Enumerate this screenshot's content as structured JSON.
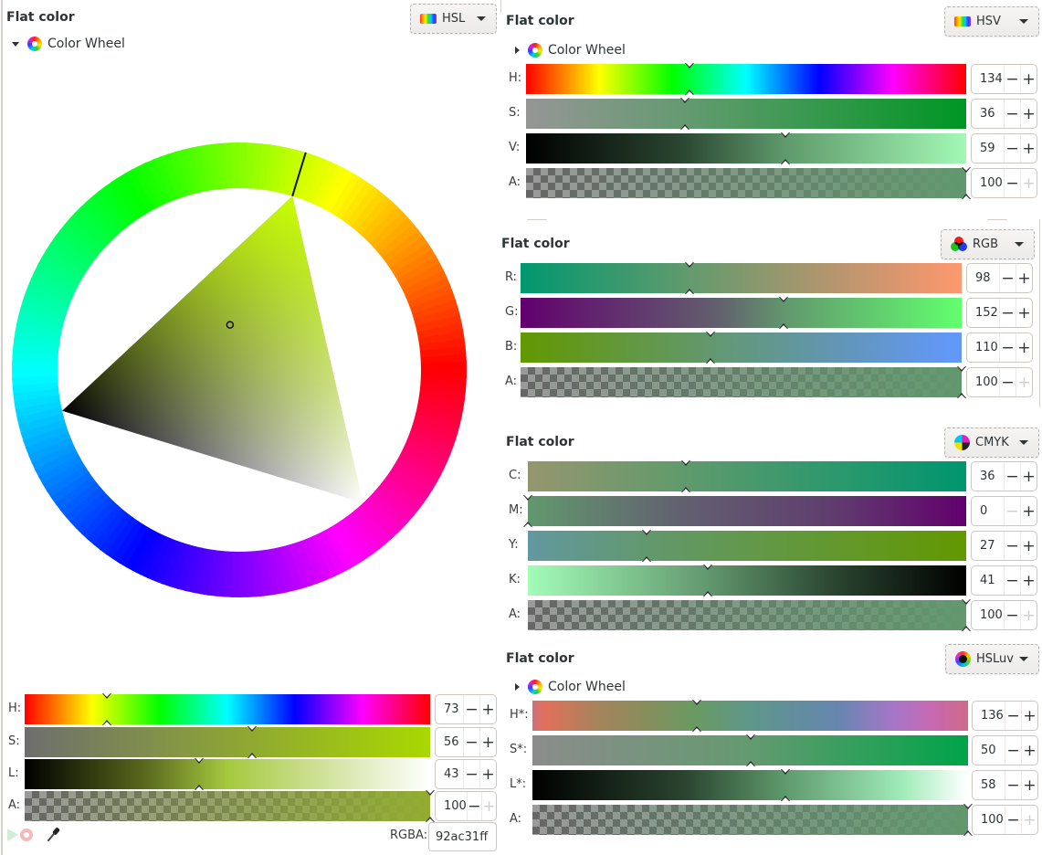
{
  "panels": {
    "hsl": {
      "title": "Flat color",
      "mode_label": "HSL",
      "mode_icon": "spectrum-icon",
      "color_wheel_label": "Color Wheel",
      "color_wheel_expanded": true,
      "wheel": {
        "hue": 73,
        "saturation": 56,
        "lightness": 43
      },
      "sliders": [
        {
          "label": "H:",
          "value": "73",
          "fraction": 0.203,
          "gradient": "hue",
          "minus_enabled": true,
          "plus_enabled": true
        },
        {
          "label": "S:",
          "value": "56",
          "fraction": 0.56,
          "gradient": "linear-gradient(90deg,#6e6e6e,#a9d800)",
          "minus_enabled": true,
          "plus_enabled": true
        },
        {
          "label": "L:",
          "value": "43",
          "fraction": 0.43,
          "gradient": "linear-gradient(90deg,#000000,#5a6a1e 30%,#a5c93e 50%,#d2e4a0 75%,#ffffff)",
          "minus_enabled": true,
          "plus_enabled": true
        },
        {
          "label": "A:",
          "value": "100",
          "fraction": 1.0,
          "gradient": "alpha",
          "alpha_color": "#92ac31",
          "minus_enabled": true,
          "plus_enabled": false
        }
      ],
      "rgba_label": "RGBA:",
      "rgba_value": "92ac31ff"
    },
    "hsv": {
      "title": "Flat color",
      "mode_label": "HSV",
      "mode_icon": "spectrum-icon",
      "color_wheel_label": "Color Wheel",
      "color_wheel_expanded": false,
      "sliders": [
        {
          "label": "H:",
          "value": "134",
          "fraction": 0.372,
          "gradient": "hue",
          "minus_enabled": true,
          "plus_enabled": true
        },
        {
          "label": "S:",
          "value": "36",
          "fraction": 0.36,
          "gradient": "linear-gradient(90deg,#969696,#5f9a6c 40%,#009624)",
          "minus_enabled": true,
          "plus_enabled": true
        },
        {
          "label": "V:",
          "value": "59",
          "fraction": 0.59,
          "gradient": "linear-gradient(90deg,#000000,#2a4530 35%,#5f9a6c 59%,#a3f8b5)",
          "minus_enabled": true,
          "plus_enabled": true
        },
        {
          "label": "A:",
          "value": "100",
          "fraction": 1.0,
          "gradient": "alpha",
          "alpha_color": "#62986e",
          "minus_enabled": true,
          "plus_enabled": false
        }
      ]
    },
    "rgb": {
      "title": "Flat color",
      "mode_label": "RGB",
      "mode_icon": "rgb-circles-icon",
      "sliders": [
        {
          "label": "R:",
          "value": "98",
          "fraction": 0.384,
          "gradient": "linear-gradient(90deg,#00986e,#629a6e 38%,#b3956e 70%,#ff986e)",
          "minus_enabled": true,
          "plus_enabled": true
        },
        {
          "label": "G:",
          "value": "152",
          "fraction": 0.596,
          "gradient": "linear-gradient(90deg,#62006e,#62606e 45%,#62986e 60%,#62ff6e)",
          "minus_enabled": true,
          "plus_enabled": true
        },
        {
          "label": "B:",
          "value": "110",
          "fraction": 0.431,
          "gradient": "linear-gradient(90deg,#629800,#62986e 43%,#6296b0 70%,#6298ff)",
          "minus_enabled": true,
          "plus_enabled": true
        },
        {
          "label": "A:",
          "value": "100",
          "fraction": 1.0,
          "gradient": "alpha",
          "alpha_color": "#62986e",
          "minus_enabled": true,
          "plus_enabled": false
        }
      ]
    },
    "cmyk": {
      "title": "Flat color",
      "mode_label": "CMYK",
      "mode_icon": "cmyk-icon",
      "sliders": [
        {
          "label": "C:",
          "value": "36",
          "fraction": 0.36,
          "gradient": "linear-gradient(90deg,#96966e,#5f9a6c 36%,#00966e)",
          "minus_enabled": true,
          "plus_enabled": true
        },
        {
          "label": "M:",
          "value": "0",
          "fraction": 0.0,
          "gradient": "linear-gradient(90deg,#62986e,#626070 35%,#603c6e 70%,#62006e)",
          "minus_enabled": false,
          "plus_enabled": true
        },
        {
          "label": "Y:",
          "value": "27",
          "fraction": 0.27,
          "gradient": "linear-gradient(90deg,#6298a0,#62986e 27%,#629800)",
          "minus_enabled": true,
          "plus_enabled": true
        },
        {
          "label": "K:",
          "value": "41",
          "fraction": 0.41,
          "gradient": "linear-gradient(90deg,#a3fcb8,#62986e 41%,#2a4530 70%,#000000)",
          "minus_enabled": true,
          "plus_enabled": true
        },
        {
          "label": "A:",
          "value": "100",
          "fraction": 1.0,
          "gradient": "alpha",
          "alpha_color": "#62986e",
          "minus_enabled": true,
          "plus_enabled": false
        }
      ]
    },
    "hsluv": {
      "title": "Flat color",
      "mode_label": "HSLuv",
      "mode_icon": "hsluv-icon",
      "color_wheel_label": "Color Wheel",
      "color_wheel_expanded": false,
      "sliders": [
        {
          "label": "H*:",
          "value": "136",
          "fraction": 0.378,
          "gradient": "linear-gradient(90deg,#d07078,#e0705a 3%,#a6845c 15%,#8a8c5c 25%,#6a9a62 37%,#5e968a 50%,#6686b0 70%,#a676c8 83%,#c868b0 92%,#d06a88)",
          "minus_enabled": true,
          "plus_enabled": true
        },
        {
          "label": "S*:",
          "value": "50",
          "fraction": 0.5,
          "gradient": "linear-gradient(90deg,#8c8c8c,#649a70 50%,#00a448)",
          "minus_enabled": true,
          "plus_enabled": true
        },
        {
          "label": "L*:",
          "value": "58",
          "fraction": 0.58,
          "gradient": "linear-gradient(90deg,#000000,#2a4530 35%,#5f9a6c 58%,#a0ecb8 85%,#ffffff)",
          "minus_enabled": true,
          "plus_enabled": true
        },
        {
          "label": "A:",
          "value": "100",
          "fraction": 1.0,
          "gradient": "alpha",
          "alpha_color": "#62986e",
          "minus_enabled": true,
          "plus_enabled": false
        }
      ]
    }
  },
  "icons": {
    "minus": "−",
    "plus": "+"
  }
}
